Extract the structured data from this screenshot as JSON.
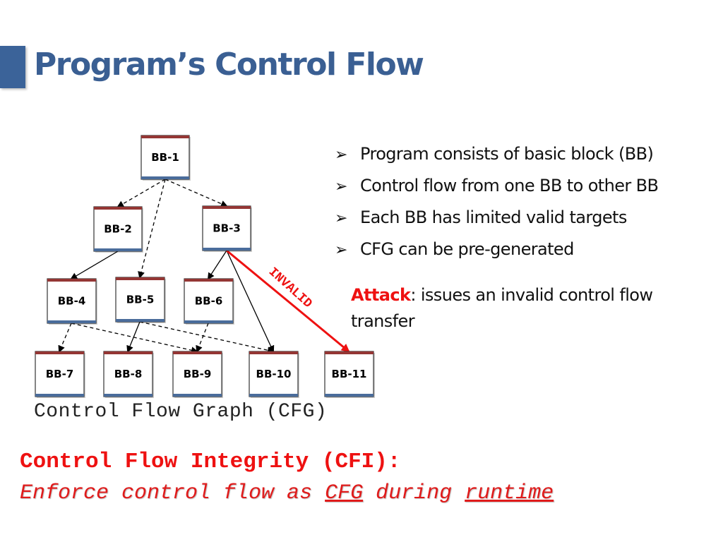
{
  "slide": {
    "title": "Program’s Control Flow",
    "accent_color": "#3b6399"
  },
  "diagram": {
    "caption": "Control Flow Graph (CFG)",
    "invalid_label": "INVALID",
    "colors": {
      "box_top": "#943634",
      "box_bottom": "#4a6c9b",
      "invalid": "#ee1111",
      "edge": "#000000"
    },
    "nodes": [
      {
        "id": "BB-1",
        "label": "BB-1"
      },
      {
        "id": "BB-2",
        "label": "BB-2"
      },
      {
        "id": "BB-3",
        "label": "BB-3"
      },
      {
        "id": "BB-4",
        "label": "BB-4"
      },
      {
        "id": "BB-5",
        "label": "BB-5"
      },
      {
        "id": "BB-6",
        "label": "BB-6"
      },
      {
        "id": "BB-7",
        "label": "BB-7"
      },
      {
        "id": "BB-8",
        "label": "BB-8"
      },
      {
        "id": "BB-9",
        "label": "BB-9"
      },
      {
        "id": "BB-10",
        "label": "BB-10"
      },
      {
        "id": "BB-11",
        "label": "BB-11"
      }
    ],
    "edges": [
      {
        "from": "BB-1",
        "to": "BB-2",
        "style": "dashed"
      },
      {
        "from": "BB-1",
        "to": "BB-3",
        "style": "dashed"
      },
      {
        "from": "BB-1",
        "to": "BB-5",
        "style": "dashed"
      },
      {
        "from": "BB-2",
        "to": "BB-4",
        "style": "solid"
      },
      {
        "from": "BB-3",
        "to": "BB-6",
        "style": "solid"
      },
      {
        "from": "BB-3",
        "to": "BB-10",
        "style": "solid"
      },
      {
        "from": "BB-3",
        "to": "BB-11",
        "style": "invalid"
      },
      {
        "from": "BB-4",
        "to": "BB-7",
        "style": "dashed"
      },
      {
        "from": "BB-4",
        "to": "BB-9",
        "style": "dashed"
      },
      {
        "from": "BB-5",
        "to": "BB-8",
        "style": "solid"
      },
      {
        "from": "BB-5",
        "to": "BB-10",
        "style": "dashed"
      },
      {
        "from": "BB-6",
        "to": "BB-9",
        "style": "dashed"
      }
    ]
  },
  "bullets": [
    {
      "icon": "arrowhead-bullet-icon",
      "text": "Program consists of basic block (BB)"
    },
    {
      "icon": "arrowhead-bullet-icon",
      "text": "Control flow from one BB to other BB"
    },
    {
      "icon": "arrowhead-bullet-icon",
      "text": "Each BB has limited valid targets"
    },
    {
      "icon": "arrowhead-bullet-icon",
      "text": "CFG can be pre-generated"
    }
  ],
  "attack": {
    "keyword": "Attack",
    "text": ": issues an invalid control flow transfer"
  },
  "cfi": {
    "title": "Control Flow Integrity (CFI):",
    "sub_part1": "Enforce control flow as ",
    "sub_cfg": "CFG",
    "sub_part2": " during ",
    "sub_runtime": "runtime"
  }
}
